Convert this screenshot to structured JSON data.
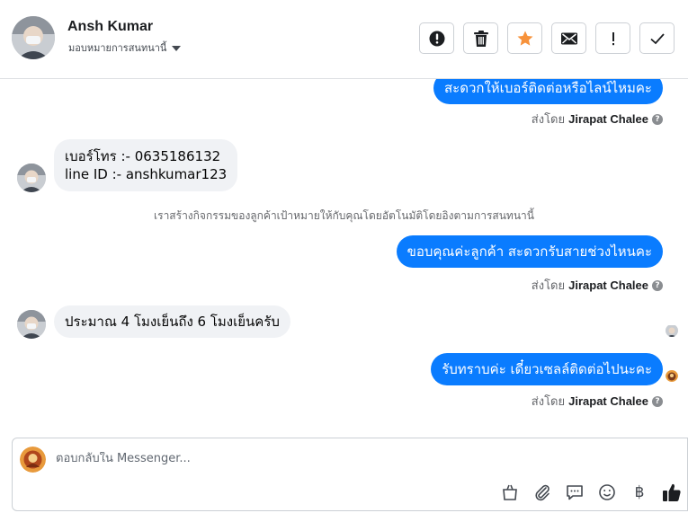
{
  "header": {
    "customer_name": "Ansh Kumar",
    "assign_label": "มอบหมายการสนทนานี้",
    "toolbar": [
      {
        "icon": "alert-circle-icon",
        "label": "Mark as spam"
      },
      {
        "icon": "trash-icon",
        "label": "Delete"
      },
      {
        "icon": "star-icon",
        "label": "Star"
      },
      {
        "icon": "envelope-icon",
        "label": "Mark unread"
      },
      {
        "icon": "exclamation-icon",
        "label": "Follow up"
      },
      {
        "icon": "checkmark-icon",
        "label": "Done"
      }
    ]
  },
  "messages": [
    {
      "from": "page",
      "text": "สะดวกให้เบอร์ติดต่อหรือไลน์ไหมคะ"
    },
    {
      "meta": "sent_by",
      "prefix": "ส่งโดย",
      "agent": "Jirapat Chalee"
    },
    {
      "from": "customer",
      "lines": [
        "เบอร์โทร :- 0635186132",
        "line ID :- anshkumar123"
      ]
    },
    {
      "system": "เราสร้างกิจกรรมของลูกค้าเป้าหมายให้กับคุณโดยอัตโนมัติโดยอิงตามการสนทนานี้"
    },
    {
      "from": "page",
      "text": "ขอบคุณค่ะลูกค้า สะดวกรับสายช่วงไหนคะ"
    },
    {
      "meta": "sent_by",
      "prefix": "ส่งโดย",
      "agent": "Jirapat Chalee"
    },
    {
      "from": "customer",
      "text": "ประมาณ 4 โมงเย็นถึง 6 โมงเย็นครับ"
    },
    {
      "from": "page",
      "text": "รับทราบค่ะ เดี๋ยวเซลล์ติดต่อไปนะคะ"
    },
    {
      "meta": "sent_by",
      "prefix": "ส่งโดย",
      "agent": "Jirapat Chalee"
    }
  ],
  "help_glyph": "?",
  "composer": {
    "placeholder": "ตอบกลับใน Messenger...",
    "tools": [
      "shopping-bag-icon",
      "paperclip-icon",
      "speech-bubble-icon",
      "smiley-icon",
      "baht-icon",
      "thumbs-up-icon"
    ],
    "baht_symbol": "฿"
  },
  "colors": {
    "outgoing_bubble": "#0a7cff",
    "incoming_bubble": "#f0f2f5",
    "star_accent": "#f7923b"
  }
}
